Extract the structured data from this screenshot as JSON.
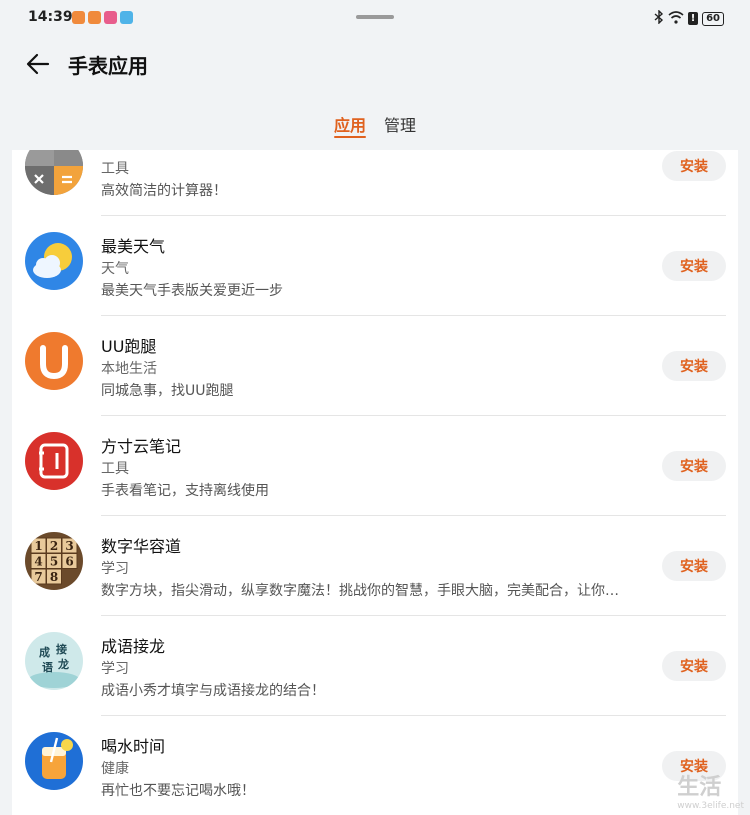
{
  "status_bar": {
    "time": "14:39",
    "battery": "60"
  },
  "header": {
    "title": "手表应用"
  },
  "tabs": [
    {
      "label": "应用",
      "active": true
    },
    {
      "label": "管理",
      "active": false
    }
  ],
  "accent_color": "#e0621f",
  "apps": [
    {
      "name": "",
      "category": "工具",
      "description": "高效简洁的计算器！",
      "button": "安装",
      "icon": "calculator-icon"
    },
    {
      "name": "最美天气",
      "category": "天气",
      "description": "最美天气手表版关爱更近一步",
      "button": "安装",
      "icon": "weather-icon"
    },
    {
      "name": "UU跑腿",
      "category": "本地生活",
      "description": "同城急事，找UU跑腿",
      "button": "安装",
      "icon": "uu-errand-icon"
    },
    {
      "name": "方寸云笔记",
      "category": "工具",
      "description": "手表看笔记，支持离线使用",
      "button": "安装",
      "icon": "notebook-icon"
    },
    {
      "name": "数字华容道",
      "category": "学习",
      "description": "数字方块，指尖滑动，纵享数字魔法！挑战你的智慧，手眼大脑，完美配合，让你…",
      "button": "安装",
      "icon": "number-puzzle-icon"
    },
    {
      "name": "成语接龙",
      "category": "学习",
      "description": "成语小秀才填字与成语接龙的结合！",
      "button": "安装",
      "icon": "idiom-icon",
      "icon_text": [
        "成",
        "接",
        "语",
        "龙"
      ]
    },
    {
      "name": "喝水时间",
      "category": "健康",
      "description": "再忙也不要忘记喝水哦！",
      "button": "安装",
      "icon": "drink-water-icon"
    }
  ],
  "puzzle_tiles": [
    "1",
    "2",
    "3",
    "4",
    "5",
    "6",
    "7",
    "8"
  ],
  "watermark": {
    "text": "生活",
    "url": "www.3elife.net"
  }
}
